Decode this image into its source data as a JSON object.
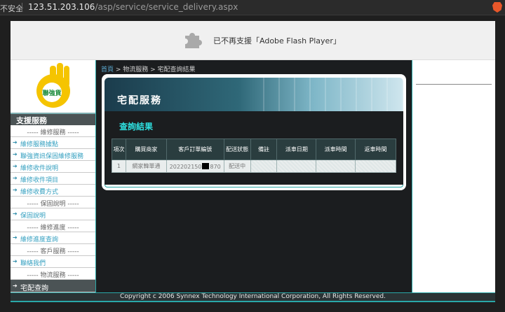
{
  "browser": {
    "security_label": "不安全",
    "host": "123.51.203.106",
    "path": "/asp/service/service_delivery.aspx"
  },
  "flash": {
    "message": "已不再支援「Adobe Flash Player」",
    "icon": "puzzle-icon"
  },
  "logo": {
    "text": "聯強貨"
  },
  "sidebar": {
    "header": "支援服務",
    "items": [
      {
        "type": "section",
        "label": "----- 維修服務 -----"
      },
      {
        "type": "link",
        "label": "維修服務據點"
      },
      {
        "type": "link",
        "label": "聯強資訊保固維修服務"
      },
      {
        "type": "link",
        "label": "維修收件說明"
      },
      {
        "type": "link",
        "label": "維修收件項目"
      },
      {
        "type": "link",
        "label": "維修收費方式"
      },
      {
        "type": "section",
        "label": "----- 保固說明 -----"
      },
      {
        "type": "link",
        "label": "保固說明"
      },
      {
        "type": "section",
        "label": "----- 維修進度 -----"
      },
      {
        "type": "link",
        "label": "維修進度查詢"
      },
      {
        "type": "section",
        "label": "----- 客戶服務 -----"
      },
      {
        "type": "link",
        "label": "聯絡我們"
      },
      {
        "type": "section",
        "label": "----- 物流服務 -----"
      },
      {
        "type": "active",
        "label": "宅配查詢"
      }
    ]
  },
  "breadcrumb": {
    "home": "首頁",
    "rest": " > 物流服務 > 宅配查詢結果"
  },
  "banner": {
    "title": "宅配服務"
  },
  "result": {
    "title": "查詢結果",
    "columns": [
      "項次",
      "購買商家",
      "客戶訂單編號",
      "配送狀態",
      "備註",
      "派車日期",
      "派車時間",
      "返車時間"
    ],
    "rows": [
      {
        "index": "1",
        "merchant": "網家韓單通",
        "order_prefix": "202202150",
        "order_suffix": "870",
        "status": "配送中",
        "note": "",
        "dispatch_date": "",
        "dispatch_time": "",
        "return_time": ""
      }
    ]
  },
  "footer": {
    "text": "Copyright c 2006 Synnex Technology International Corporation, All Rights Reserved."
  },
  "colors": {
    "accent": "#2aa8a8",
    "result_title": "#2ee0e0",
    "link": "#35a0c0"
  }
}
